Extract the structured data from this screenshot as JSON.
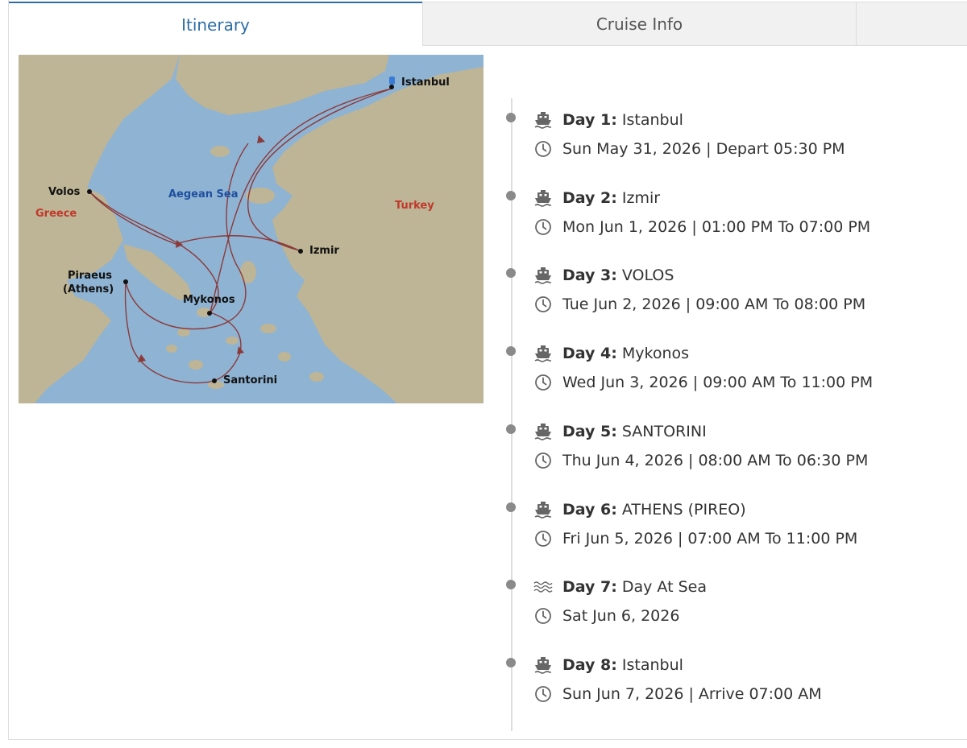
{
  "tabs": {
    "itinerary": "Itinerary",
    "cruise_info": "Cruise Info"
  },
  "map": {
    "labels": {
      "istanbul": "Istanbul",
      "volos": "Volos",
      "greece": "Greece",
      "aegean_sea": "Aegean Sea",
      "turkey": "Turkey",
      "izmir": "Izmir",
      "piraeus": "Piraeus",
      "athens": "(Athens)",
      "mykonos": "Mykonos",
      "santorini": "Santorini"
    },
    "colors": {
      "land": "#bdb596",
      "sea": "#8fb3d3",
      "route": "#8b3a3a",
      "sea_label": "#1f4f9f",
      "country_label": "#c0392b"
    }
  },
  "itinerary": [
    {
      "day": "Day 1:",
      "port": "Istanbul",
      "icon": "ship-icon",
      "date": "Sun May 31, 2026 | Depart 05:30 PM"
    },
    {
      "day": "Day 2:",
      "port": "Izmir",
      "icon": "ship-icon",
      "date": "Mon Jun 1, 2026 | 01:00 PM To 07:00 PM"
    },
    {
      "day": "Day 3:",
      "port": "VOLOS",
      "icon": "ship-icon",
      "date": "Tue Jun 2, 2026 | 09:00 AM To 08:00 PM"
    },
    {
      "day": "Day 4:",
      "port": "Mykonos",
      "icon": "ship-icon",
      "date": "Wed Jun 3, 2026 | 09:00 AM To 11:00 PM"
    },
    {
      "day": "Day 5:",
      "port": "SANTORINI",
      "icon": "ship-icon",
      "date": "Thu Jun 4, 2026 | 08:00 AM To 06:30 PM"
    },
    {
      "day": "Day 6:",
      "port": "ATHENS (PIREO)",
      "icon": "ship-icon",
      "date": "Fri Jun 5, 2026 | 07:00 AM To 11:00 PM"
    },
    {
      "day": "Day 7:",
      "port": "Day At Sea",
      "icon": "waves-icon",
      "date": "Sat Jun 6, 2026"
    },
    {
      "day": "Day 8:",
      "port": "Istanbul",
      "icon": "ship-icon",
      "date": "Sun Jun 7, 2026 | Arrive 07:00 AM"
    }
  ]
}
